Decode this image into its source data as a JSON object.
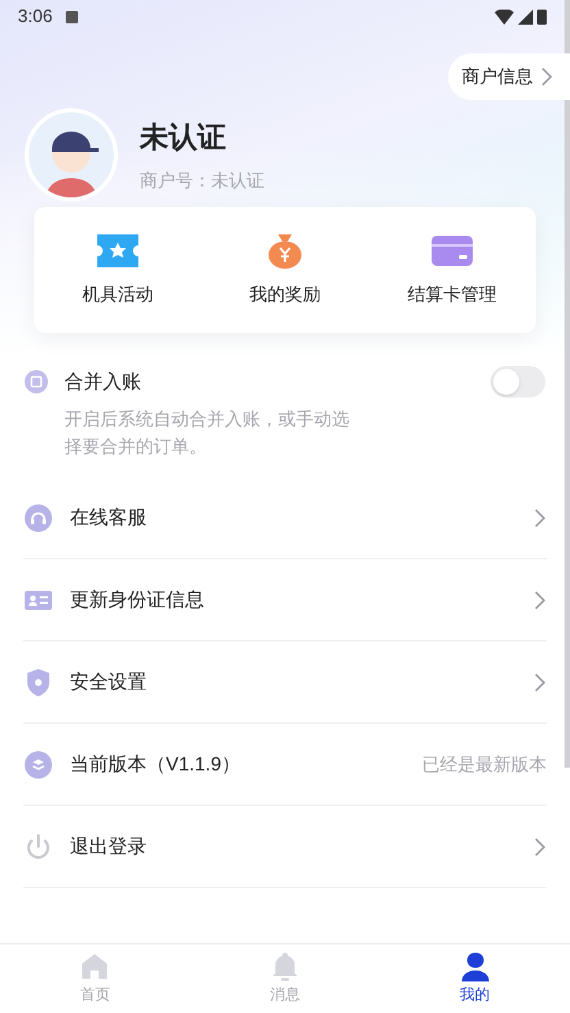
{
  "status_bar": {
    "time": "3:06"
  },
  "merchant_info_button": {
    "label": "商户信息"
  },
  "profile": {
    "name": "未认证",
    "merchant_no": "商户号：未认证"
  },
  "shortcuts": [
    {
      "label": "机具活动"
    },
    {
      "label": "我的奖励"
    },
    {
      "label": "结算卡管理"
    }
  ],
  "merge_setting": {
    "title": "合并入账",
    "on": false,
    "description": "开启后系统自动合并入账，或手动选择要合并的订单。"
  },
  "menu": [
    {
      "kind": "link",
      "label": "在线客服"
    },
    {
      "kind": "link",
      "label": "更新身份证信息"
    },
    {
      "kind": "link",
      "label": "安全设置"
    },
    {
      "kind": "version",
      "label": "当前版本（V1.1.9）",
      "note": "已经是最新版本"
    },
    {
      "kind": "link",
      "label": "退出登录"
    }
  ],
  "bottom_nav": [
    {
      "label": "首页",
      "selected": false
    },
    {
      "label": "消息",
      "selected": false
    },
    {
      "label": "我的",
      "selected": true
    }
  ]
}
